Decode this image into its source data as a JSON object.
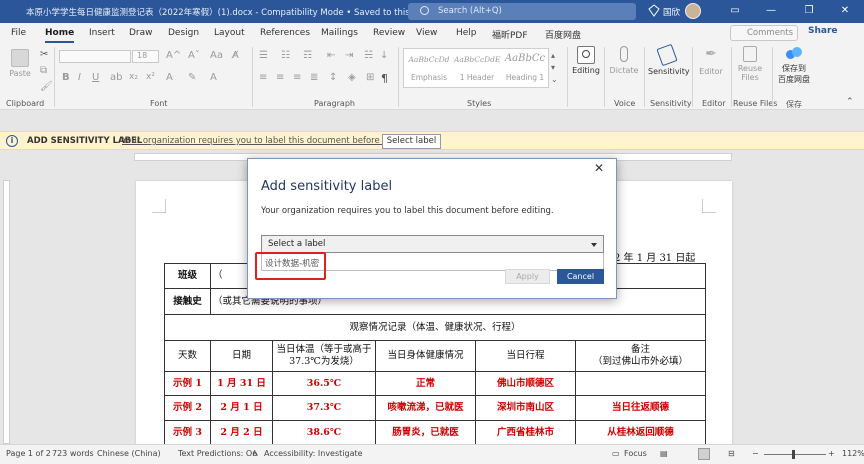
{
  "window": {
    "title": "本原小学学生每日健康监测登记表（2022年寒假）(1).docx  -  Compatibility Mode • Saved to this PC",
    "search_placeholder": "Search (Alt+Q)",
    "user_name": "国欣",
    "minimize": "—",
    "restore": "❐",
    "close": "✕"
  },
  "menu": {
    "tabs": [
      "File",
      "Home",
      "Insert",
      "Draw",
      "Design",
      "Layout",
      "References",
      "Mailings",
      "Review",
      "View",
      "Help",
      "福昕PDF",
      "百度网盘"
    ],
    "active_tab": "Home",
    "comments": "Comments",
    "share": "Share"
  },
  "ribbon": {
    "clipboard": {
      "paste": "Paste",
      "label": "Clipboard"
    },
    "font": {
      "size": "18",
      "label": "Font"
    },
    "paragraph": {
      "label": "Paragraph"
    },
    "styles": {
      "label": "Styles",
      "items": [
        {
          "preview": "AaBbCcDd",
          "name": "Emphasis"
        },
        {
          "preview": "AaBbCcDdE",
          "name": "1 Header"
        },
        {
          "preview": "AaBbCc",
          "name": "Heading 1"
        }
      ]
    },
    "editing": {
      "button": "Editing"
    },
    "voice": {
      "button": "Dictate",
      "label": "Voice"
    },
    "sensitivity": {
      "button": "Sensitivity",
      "label": "Sensitivity"
    },
    "editor": {
      "button": "Editor",
      "label": "Editor"
    },
    "reuse": {
      "button_line1": "Reuse",
      "button_line2": "Files",
      "label": "Reuse Files"
    },
    "baidu": {
      "button_line1": "保存到",
      "button_line2": "百度网盘",
      "label": "保存"
    }
  },
  "infobar": {
    "icon": "i",
    "heading": "ADD SENSITIVITY LABEL",
    "message": "Your organization requires you to label this document before editing.",
    "button": "Select label"
  },
  "document": {
    "header_text": "2 年 1 月 31 日起",
    "rows": {
      "class_label": "班级",
      "class_value": "（",
      "contact_label": "接触史",
      "contact_value": "（或其它需要说明的事项）",
      "section_title": "观察情况记录（体温、健康状况、行程）"
    },
    "columns": [
      "天数",
      "日期",
      "当日体温（等于或高于 37.3℃为发烧）",
      "当日身体健康情况",
      "当日行程",
      "备注\n（到过佛山市外必填）"
    ],
    "examples": [
      [
        "示例 1",
        "1 月 31 日",
        "36.5℃",
        "正常",
        "佛山市顺德区",
        ""
      ],
      [
        "示例 2",
        "2 月 1 日",
        "37.3℃",
        "咳嗽流涕，已就医",
        "深圳市南山区",
        "当日往返顺德"
      ],
      [
        "示例 3",
        "2 月 2 日",
        "38.6℃",
        "肠胃炎，已就医",
        "广西省桂林市",
        "从桂林返回顺德"
      ]
    ]
  },
  "dialog": {
    "title": "Add sensitivity label",
    "close": "✕",
    "description": "Your organization requires you to label this document before editing.",
    "select_placeholder": "Select a label",
    "option": "设计数据-机密",
    "apply": "Apply",
    "cancel": "Cancel"
  },
  "status": {
    "page": "Page 1 of 2",
    "words": "723 words",
    "language": "Chinese (China)",
    "predictions": "Text Predictions: On",
    "accessibility": "Accessibility: Investigate",
    "focus": "Focus",
    "zoom": "112%"
  }
}
